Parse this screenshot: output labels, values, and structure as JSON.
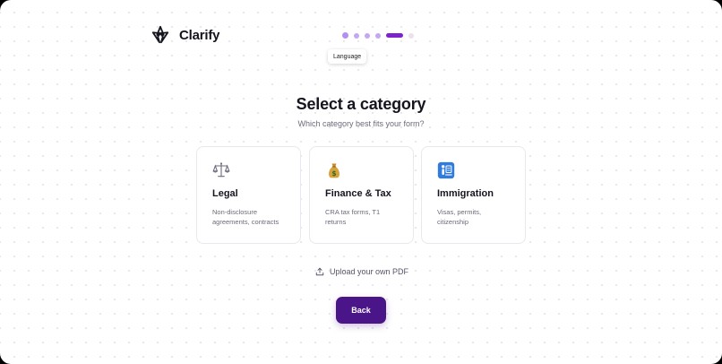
{
  "header": {
    "brand": "Clarify"
  },
  "stepper": {
    "steps": [
      "done",
      "done",
      "done",
      "done",
      "active",
      "future"
    ],
    "tooltip": "Language"
  },
  "main": {
    "title": "Select a category",
    "subtitle": "Which category best fits your form?",
    "categories": [
      {
        "title": "Legal",
        "description": "Non-disclosure agreements, contracts",
        "icon": "balance-scale-icon"
      },
      {
        "title": "Finance & Tax",
        "description": "CRA tax forms, T1 returns",
        "icon": "money-bag-icon"
      },
      {
        "title": "Immigration",
        "description": "Visas, permits, citizenship",
        "icon": "passport-control-icon"
      }
    ],
    "upload_label": "Upload your own PDF"
  },
  "footer": {
    "back_label": "Back"
  },
  "colors": {
    "accent": "#7e22ce",
    "back_button": "#4a1589",
    "text": "#15151f",
    "muted": "#6b6b7b"
  }
}
